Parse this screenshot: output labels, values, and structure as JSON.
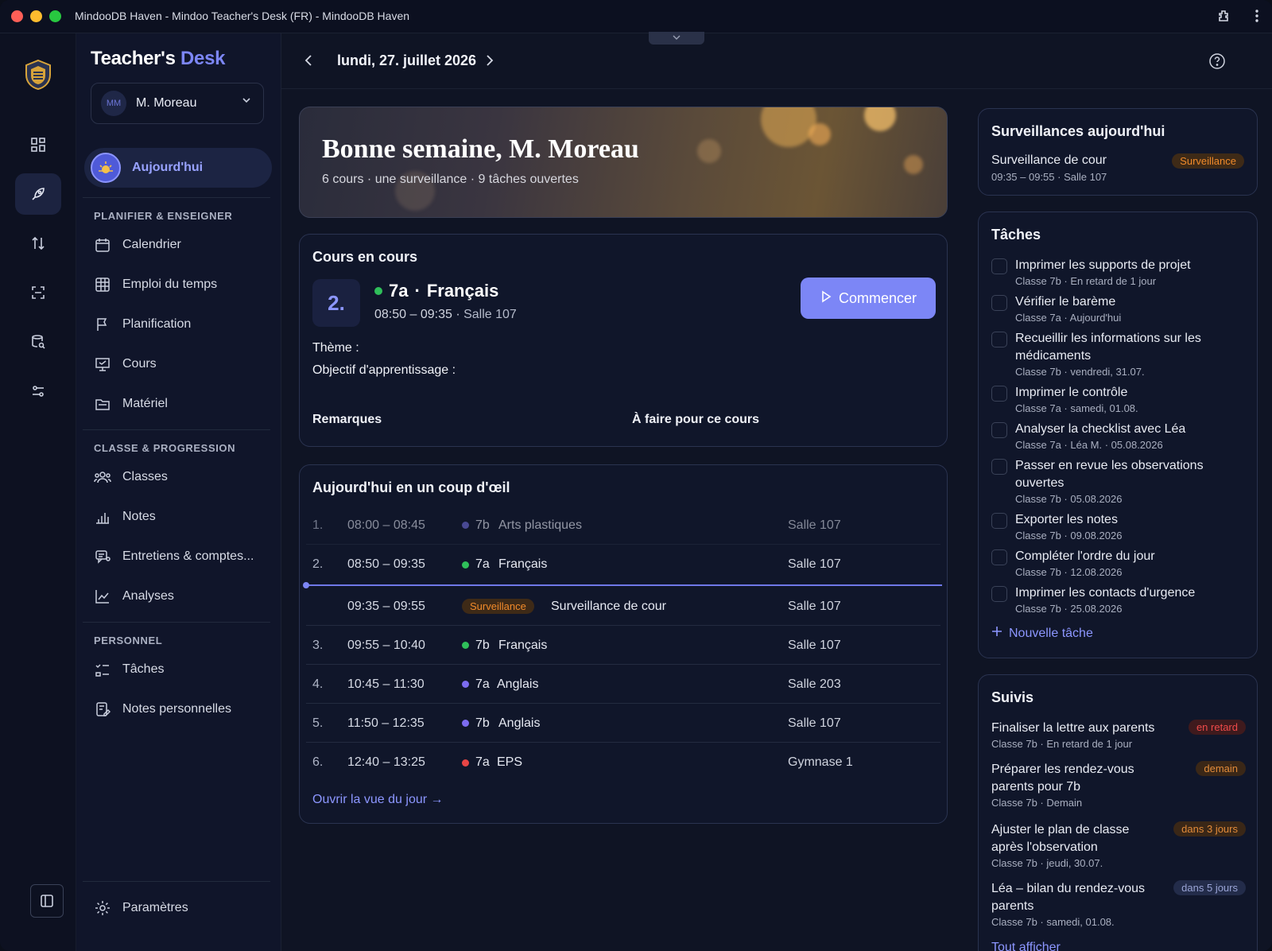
{
  "window": {
    "title": "MindooDB Haven - Mindoo Teacher's Desk (FR) - MindooDB Haven"
  },
  "brand": {
    "part1": "Teacher's",
    "part2": "Desk"
  },
  "user": {
    "initials": "MM",
    "name": "M. Moreau"
  },
  "sidebar": {
    "today_label": "Aujourd'hui",
    "section1": "PLANIFIER & ENSEIGNER",
    "section2": "CLASSE & PROGRESSION",
    "section3": "PERSONNEL",
    "items": [
      "Calendrier",
      "Emploi du temps",
      "Planification",
      "Cours",
      "Matériel",
      "Classes",
      "Notes",
      "Entretiens & comptes...",
      "Analyses",
      "Tâches",
      "Notes personnelles"
    ],
    "settings": "Paramètres"
  },
  "date": {
    "label": "lundi, 27. juillet 2026"
  },
  "hero": {
    "title": "Bonne semaine, M. Moreau",
    "subtitle": "6 cours · une surveillance · 9 tâches ouvertes"
  },
  "current": {
    "title": "Cours en cours",
    "period": "2.",
    "class": "7a",
    "sep": "·",
    "subject": "Français",
    "time": "08:50 – 09:35",
    "room": "Salle 107",
    "start_label": "Commencer",
    "theme_label": "Thème :",
    "objective_label": "Objectif d'apprentissage :",
    "remarks_label": "Remarques",
    "todo_label": "À faire pour ce cours"
  },
  "glance": {
    "title": "Aujourd'hui en un coup d'œil",
    "rows": [
      {
        "num": "1.",
        "time": "08:00 – 08:45",
        "cls": "7b",
        "subject": "Arts plastiques",
        "room": "Salle 107",
        "color": "#6f6bd9"
      },
      {
        "num": "2.",
        "time": "08:50 – 09:35",
        "cls": "7a",
        "subject": "Français",
        "room": "Salle 107",
        "color": "#2fbf5a"
      },
      {
        "num": "",
        "time": "09:35 – 09:55",
        "badge": "Surveillance",
        "subject": "Surveillance de cour",
        "room": "Salle 107"
      },
      {
        "num": "3.",
        "time": "09:55 – 10:40",
        "cls": "7b",
        "subject": "Français",
        "room": "Salle 107",
        "color": "#2fbf5a"
      },
      {
        "num": "4.",
        "time": "10:45 – 11:30",
        "cls": "7a",
        "subject": "Anglais",
        "room": "Salle 203",
        "color": "#7c6cf0"
      },
      {
        "num": "5.",
        "time": "11:50 – 12:35",
        "cls": "7b",
        "subject": "Anglais",
        "room": "Salle 107",
        "color": "#7c6cf0"
      },
      {
        "num": "6.",
        "time": "12:40 – 13:25",
        "cls": "7a",
        "subject": "EPS",
        "room": "Gymnase 1",
        "color": "#e84545"
      }
    ],
    "link": "Ouvrir la vue du jour →"
  },
  "surveillance": {
    "title": "Surveillances aujourd'hui",
    "item": "Surveillance de cour",
    "meta": "09:35 – 09:55 · Salle 107",
    "badge": "Surveillance"
  },
  "tasks": {
    "title": "Tâches",
    "items": [
      {
        "title": "Imprimer les supports de projet",
        "meta": "Classe 7b · En retard de 1 jour"
      },
      {
        "title": "Vérifier le barème",
        "meta": "Classe 7a · Aujourd'hui"
      },
      {
        "title": "Recueillir les informations sur les médicaments",
        "meta": "Classe 7b · vendredi, 31.07."
      },
      {
        "title": "Imprimer le contrôle",
        "meta": "Classe 7a · samedi, 01.08."
      },
      {
        "title": "Analyser la checklist avec Léa",
        "meta": "Classe 7a · Léa M. · 05.08.2026"
      },
      {
        "title": "Passer en revue les observations ouvertes",
        "meta": "Classe 7b · 05.08.2026"
      },
      {
        "title": "Exporter les notes",
        "meta": "Classe 7b · 09.08.2026"
      },
      {
        "title": "Compléter l'ordre du jour",
        "meta": "Classe 7b · 12.08.2026"
      },
      {
        "title": "Imprimer les contacts d'urgence",
        "meta": "Classe 7b · 25.08.2026"
      }
    ],
    "new_label": "Nouvelle tâche"
  },
  "followups": {
    "title": "Suivis",
    "items": [
      {
        "title": "Finaliser la lettre aux parents",
        "meta": "Classe 7b · En retard de 1 jour",
        "badge": "en retard"
      },
      {
        "title": "Préparer les rendez-vous parents pour 7b",
        "meta": "Classe 7b · Demain",
        "badge": "demain"
      },
      {
        "title": "Ajuster le plan de classe après l'observation",
        "meta": "Classe 7b · jeudi, 30.07.",
        "badge": "dans 3 jours"
      },
      {
        "title": "Léa – bilan du rendez-vous parents",
        "meta": "Classe 7b · samedi, 01.08.",
        "badge": "dans 5 jours"
      }
    ],
    "show_all": "Tout afficher"
  }
}
